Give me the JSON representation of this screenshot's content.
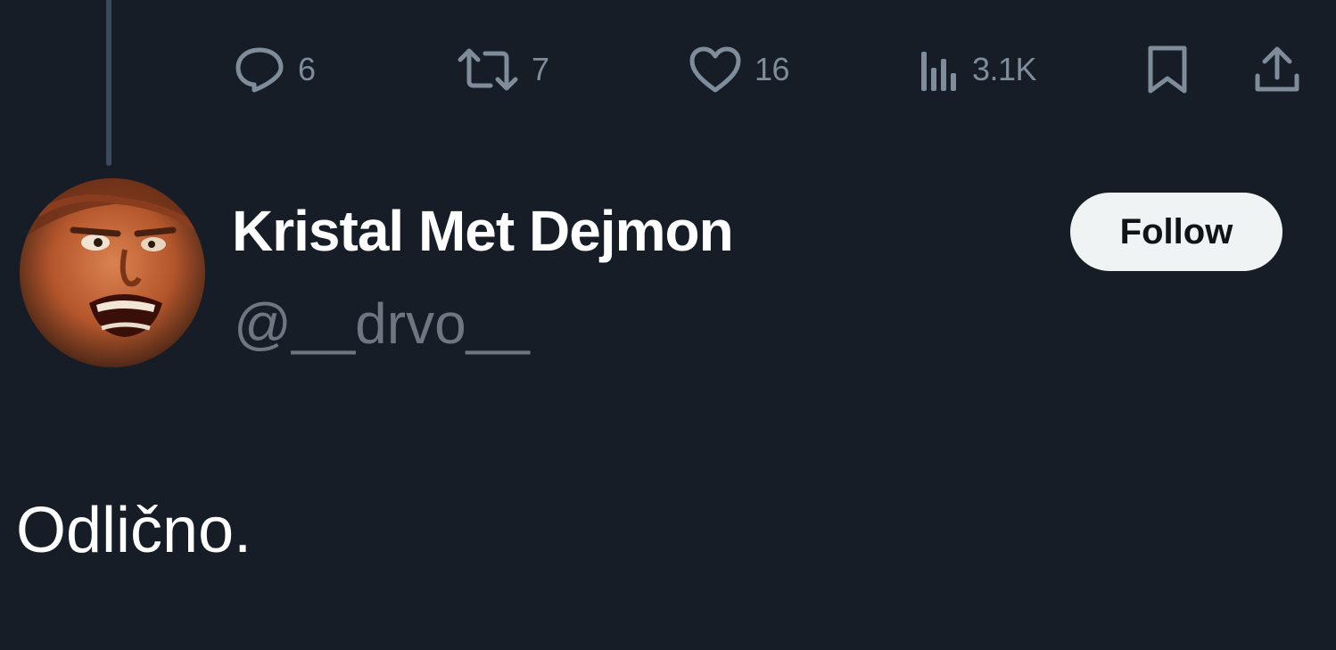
{
  "post_actions": {
    "reply_count": "6",
    "repost_count": "7",
    "like_count": "16",
    "view_count": "3.1K",
    "icons": [
      "reply-icon",
      "repost-icon",
      "like-icon",
      "views-icon",
      "bookmark-icon",
      "share-icon"
    ]
  },
  "author": {
    "display_name": "Kristal Met Dejmon",
    "handle": "@__drvo__"
  },
  "follow_button": {
    "label": "Follow"
  },
  "post": {
    "text": "Odlično."
  },
  "colors": {
    "background": "#161d27",
    "muted_text": "#7f8c99",
    "handle_text": "#6e7781",
    "follow_button_bg": "#eff3f4"
  }
}
